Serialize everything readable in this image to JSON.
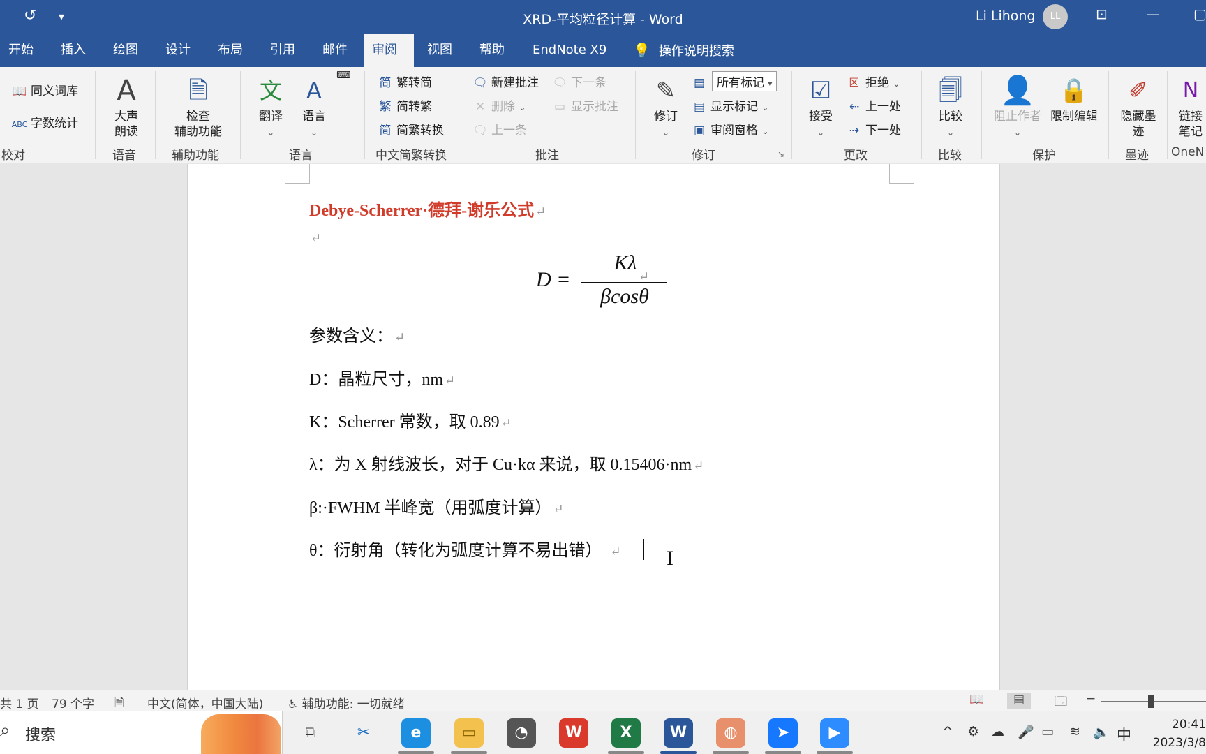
{
  "titlebar": {
    "title": "XRD-平均粒径计算  -  Word",
    "user_name": "Li Lihong",
    "avatar_initials": "LL",
    "undo_glyph": "↺",
    "customize_glyph": "▾"
  },
  "tabs": [
    "开始",
    "插入",
    "绘图",
    "设计",
    "布局",
    "引用",
    "邮件",
    "审阅",
    "视图",
    "帮助",
    "EndNote X9",
    "操作说明搜索"
  ],
  "active_tab": "审阅",
  "ribbon": {
    "proofing": {
      "thesaurus": "同义词库",
      "wordcount": "字数统计",
      "group": "校对"
    },
    "speech": {
      "read_aloud": "大声\n朗读",
      "group": "语音"
    },
    "accessibility": {
      "check": "检查\n辅助功能",
      "group": "辅助功能"
    },
    "language": {
      "translate": "翻译",
      "language": "语言",
      "group": "语言"
    },
    "chinese_conversion": {
      "to_simplified": "繁转简",
      "to_traditional": "简转繁",
      "conversion": "简繁转换",
      "group": "中文简繁转换"
    },
    "comments": {
      "new": "新建批注",
      "next": "下一条",
      "delete": "删除",
      "show": "显示批注",
      "prev": "上一条",
      "group": "批注"
    },
    "tracking": {
      "track": "修订",
      "markup_select": "所有标记",
      "show_markup": "显示标记",
      "review_pane": "审阅窗格",
      "group": "修订"
    },
    "changes": {
      "accept": "接受",
      "reject": "拒绝",
      "previous": "上一处",
      "next": "下一处",
      "group": "更改"
    },
    "compare": {
      "compare": "比较",
      "group": "比较"
    },
    "protect": {
      "block_authors": "阻止作者",
      "restrict": "限制编辑",
      "group": "保护"
    },
    "ink": {
      "hide_ink": "隐藏墨\n迹",
      "group": "墨迹"
    },
    "onenote": {
      "link_notes": "链接\n笔记",
      "group": "OneN"
    }
  },
  "document": {
    "heading": "Debye-Scherrer·德拜-谢乐公式",
    "formula": {
      "lhs": "D =",
      "numerator": "Kλ",
      "denominator": "βcosθ"
    },
    "param_title": "参数含义：",
    "params": [
      "D：晶粒尺寸，nm",
      "K：Scherrer 常数，取 0.89",
      "λ：为 X 射线波长，对于 Cu·kα 来说，取 0.15406·nm",
      "β:·FWHM 半峰宽（用弧度计算）",
      "θ：衍射角（转化为弧度计算不易出错）"
    ],
    "para_mark": "↵"
  },
  "statusbar": {
    "pages": "共 1 页",
    "words": "79 个字",
    "language": "中文(简体，中国大陆)",
    "accessibility": "辅助功能: 一切就绪"
  },
  "taskbar": {
    "search_label": "搜索",
    "time": "20:41",
    "date": "2023/3/8",
    "ime": "中"
  },
  "colors": {
    "word_blue": "#2b579a",
    "heading_red": "#d03b2a"
  }
}
